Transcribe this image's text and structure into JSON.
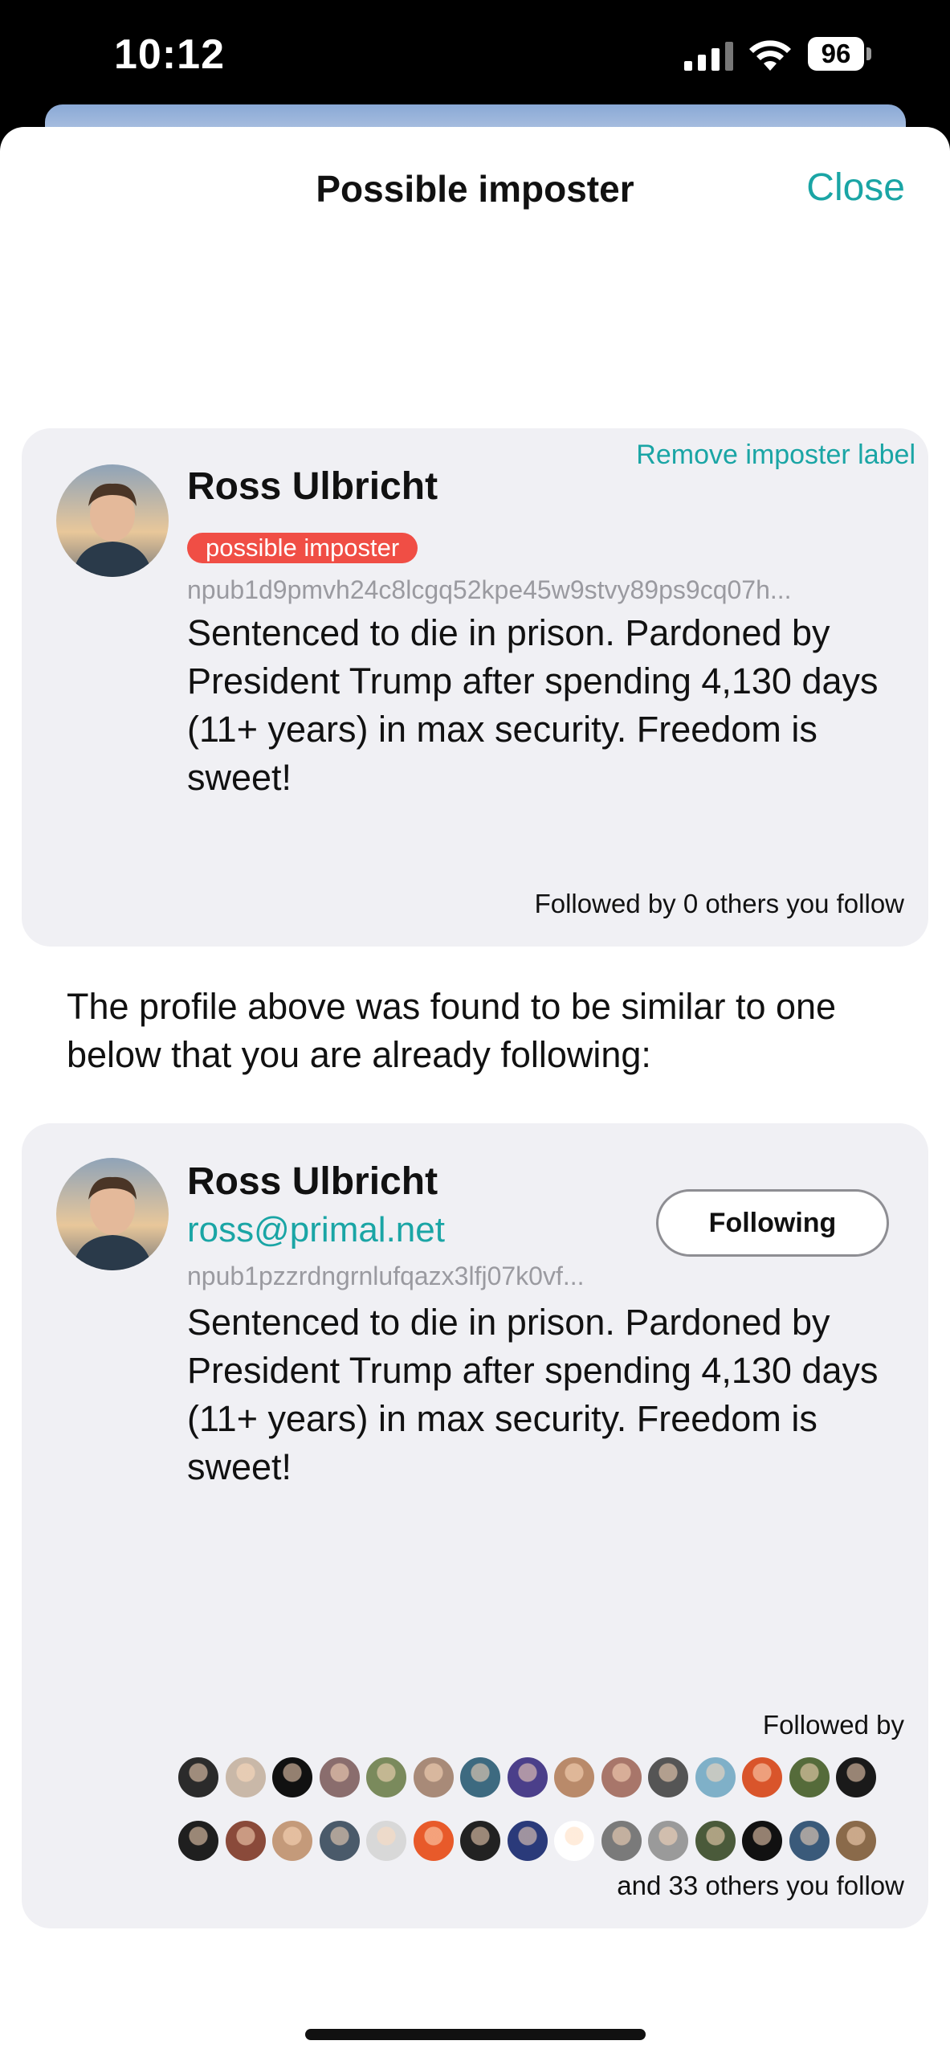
{
  "status_bar": {
    "time": "10:12",
    "battery": "96"
  },
  "sheet": {
    "title": "Possible imposter",
    "close_label": "Close"
  },
  "imposter_card": {
    "remove_label": "Remove imposter label",
    "name": "Ross Ulbricht",
    "badge": "possible imposter",
    "npub": "npub1d9pmvh24c8lcgq52kpe45w9stvy89ps9cq07h...",
    "about": "Sentenced to die in prison. Pardoned by President Trump after spending 4,130 days (11+ years) in max security. Freedom is sweet!",
    "followed_by": "Followed by 0 others you follow"
  },
  "explanation": "The profile above was found to be similar to one below that you are already following:",
  "followed_card": {
    "name": "Ross Ulbricht",
    "nip05": "ross@primal.net",
    "npub": "npub1pzzrdngrnlufqazx3lfj07k0vf...",
    "following_label": "Following",
    "about": "Sentenced to die in prison. Pardoned by President Trump after spending 4,130 days (11+ years) in max security. Freedom is sweet!",
    "followed_by_label": "Followed by",
    "others_label": "and 33 others you follow",
    "follower_avatar_colors": [
      "#2b2b2b",
      "#c9b8a8",
      "#111111",
      "#8a6d6d",
      "#7a8a5c",
      "#a88a78",
      "#3d6a80",
      "#4b3f8a",
      "#b98a6a",
      "#a8766a",
      "#555555",
      "#7fb0c8",
      "#d9552b",
      "#556b3a",
      "#1a1a1a",
      "#1f1f1f",
      "#8a4a3a",
      "#c49a7a",
      "#4a5a6a",
      "#d8d8d8",
      "#e85a2a",
      "#222222",
      "#2a3a7a",
      "#ffffff",
      "#7a7a7a",
      "#9a9a9a",
      "#4a5a3a",
      "#111111",
      "#3a5a7a",
      "#8a6a4a"
    ]
  }
}
